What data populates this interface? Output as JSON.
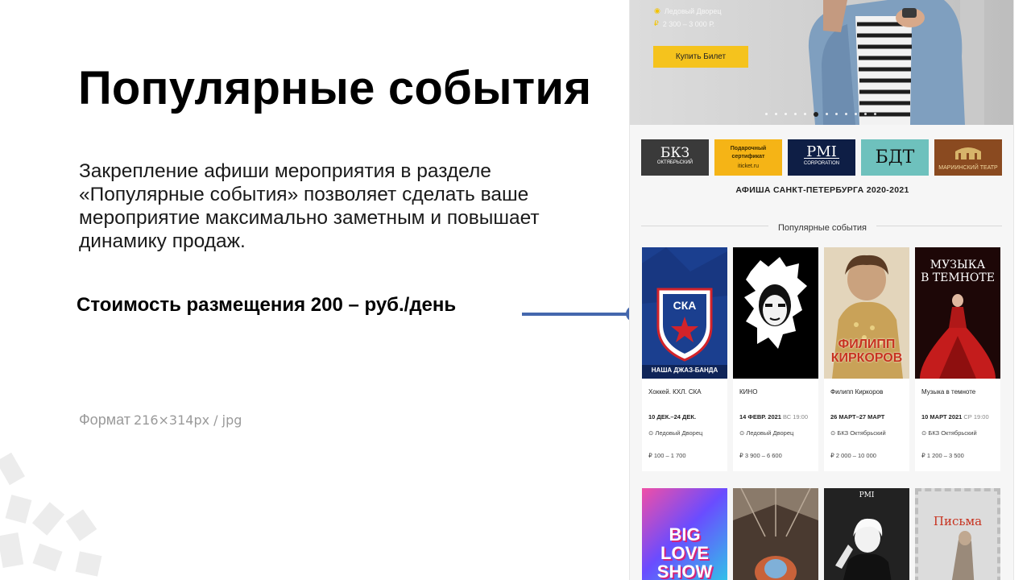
{
  "slide": {
    "title": "Популярные события",
    "description": "Закрепление афиши мероприятия в разделе «Популярные события» позволяет сделать ваше мероприятие максимально заметным и повышает динамику продаж.",
    "price": "Стоимость размещения 200 – руб./день",
    "format_label": "Формат",
    "format_spec": "216×314px / jpg"
  },
  "hero": {
    "venue": "Ледовый Дворец",
    "price": "2 300 – 3 000 Р.",
    "button": "Купить Билет",
    "dot_count": 12,
    "active_dot": 5
  },
  "partners": [
    {
      "name": "БКЗ",
      "sub": "ОКТЯБРЬСКИЙ"
    },
    {
      "name": "Подарочный сертификат",
      "sub": "iticket.ru"
    },
    {
      "name": "PMI",
      "sub": "CORPORATION"
    },
    {
      "name": "БДТ",
      "sub": ""
    },
    {
      "name": "",
      "sub": "МАРИИНСКИЙ ТЕАТР"
    }
  ],
  "site_heading": "АФИША САНКТ-ПЕТЕРБУРГА 2020-2021",
  "section_title": "Популярные события",
  "events": [
    {
      "title": "Хоккей. КХЛ. СКА",
      "date": "10 ДЕК.–24 ДЕК.",
      "weekday": "",
      "venue": "Ледовый Дворец",
      "price": "100 – 1 700",
      "poster_text": "СКА",
      "poster_caption": "НАША ДЖАЗ-БАНДА"
    },
    {
      "title": "КИНО",
      "date": "14 ФЕВР. 2021",
      "weekday": "ВС 19:00",
      "venue": "Ледовый Дворец",
      "price": "3 900 – 6 600",
      "poster_text": "",
      "poster_caption": ""
    },
    {
      "title": "Филипп Киркоров",
      "date": "26 МАРТ–27 МАРТ",
      "weekday": "",
      "venue": "БКЗ Октябрьский",
      "price": "2 000 – 10 000",
      "poster_text": "ФИЛИПП",
      "poster_caption": "КИРКОРОВ"
    },
    {
      "title": "Музыка в темноте",
      "date": "10 МАРТ 2021",
      "weekday": "СР 19:00",
      "venue": "БКЗ Октябрьский",
      "price": "1 200 – 3 500",
      "poster_text": "МУЗЫКА",
      "poster_caption": "В ТЕМНОТЕ"
    }
  ],
  "events_row2": [
    {
      "poster_text": "BIG LOVE SHOW"
    },
    {
      "poster_text": ""
    },
    {
      "poster_text": "PMI"
    },
    {
      "poster_text": "Письма"
    }
  ],
  "colors": {
    "accent_blue": "#4467ad",
    "button_yellow": "#f5c31d",
    "ska_blue": "#1b3f8f",
    "kirkorov_red": "#c7321f"
  },
  "icons": {
    "pin": "location-pin-icon",
    "ruble": "ruble-icon"
  }
}
